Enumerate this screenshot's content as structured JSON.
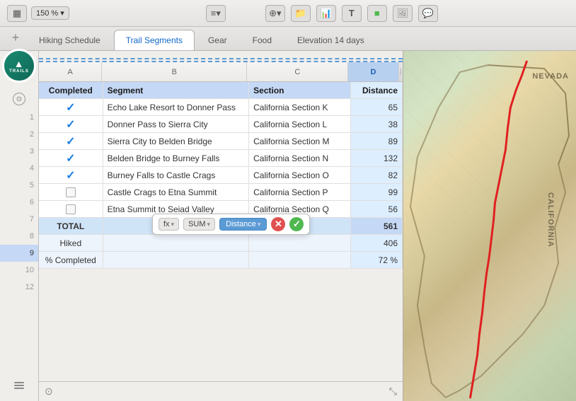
{
  "toolbar": {
    "zoom_label": "150 %",
    "view_icon": "▦",
    "list_icon": "≡",
    "add_icon": "⊕",
    "chevron": "▾"
  },
  "tabs": [
    {
      "id": "hiking",
      "label": "Hiking Schedule",
      "active": false
    },
    {
      "id": "trail",
      "label": "Trail Segments",
      "active": true
    },
    {
      "id": "gear",
      "label": "Gear",
      "active": false
    },
    {
      "id": "food",
      "label": "Food",
      "active": false
    },
    {
      "id": "elevation",
      "label": "Elevation 14 days",
      "active": false
    }
  ],
  "columns": [
    {
      "id": "A",
      "label": "A",
      "active": false
    },
    {
      "id": "B",
      "label": "B",
      "active": false
    },
    {
      "id": "C",
      "label": "C",
      "active": false
    },
    {
      "id": "D",
      "label": "D",
      "active": true
    }
  ],
  "header_row": {
    "completed": "Completed",
    "segment": "Segment",
    "section": "Section",
    "distance": "Distance"
  },
  "rows": [
    {
      "row": 2,
      "completed": true,
      "segment": "Echo Lake Resort to Donner Pass",
      "section": "California Section K",
      "distance": "65"
    },
    {
      "row": 3,
      "completed": true,
      "segment": "Donner Pass to Sierra City",
      "section": "California Section L",
      "distance": "38"
    },
    {
      "row": 4,
      "completed": true,
      "segment": "Sierra City to Belden Bridge",
      "section": "California Section M",
      "distance": "89"
    },
    {
      "row": 5,
      "completed": true,
      "segment": "Belden Bridge to Burney Falls",
      "section": "California Section N",
      "distance": "132"
    },
    {
      "row": 6,
      "completed": true,
      "segment": "Burney Falls to Castle Crags",
      "section": "California Section O",
      "distance": "82"
    },
    {
      "row": 7,
      "completed": false,
      "segment": "Castle Crags to Etna Summit",
      "section": "California Section P",
      "distance": "99"
    },
    {
      "row": 8,
      "completed": false,
      "segment": "Etna Summit to Seiad Valley",
      "section": "California Section Q",
      "distance": "56"
    }
  ],
  "total_row": {
    "row": 9,
    "label": "TOTAL",
    "value": "561"
  },
  "hiked_row": {
    "row": 10,
    "label": "Hiked",
    "value": "406"
  },
  "pct_row": {
    "row": 12,
    "label": "% Completed",
    "value": "72 %"
  },
  "formula_bar": {
    "fx_label": "fx",
    "func_label": "SUM",
    "field_label": "Distance",
    "cancel": "✕",
    "confirm": "✓"
  },
  "map": {
    "nevada_label": "NEVADA",
    "california_label": "CALIFORNIA"
  },
  "logo": {
    "line1": "▲",
    "line2": "TRAILS"
  }
}
